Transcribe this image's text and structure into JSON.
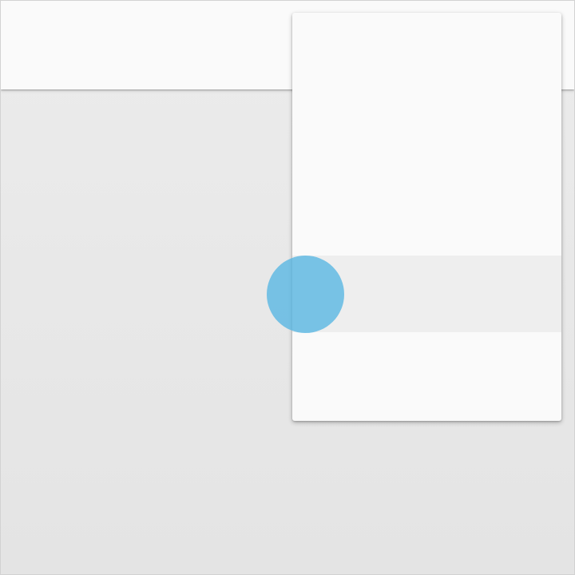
{
  "app_bar": {
    "title": ""
  },
  "popup_menu": {
    "items": [
      {
        "label": ""
      },
      {
        "label": ""
      },
      {
        "label": ""
      },
      {
        "label": ""
      },
      {
        "label": ""
      }
    ],
    "highlighted_index": 3
  },
  "colors": {
    "app_bar_background": "#fafafa",
    "screen_background": "#e8e8e8",
    "menu_background": "#fafafa",
    "menu_highlight": "#eeeeee",
    "touch_indicator": "#52b4e2"
  }
}
